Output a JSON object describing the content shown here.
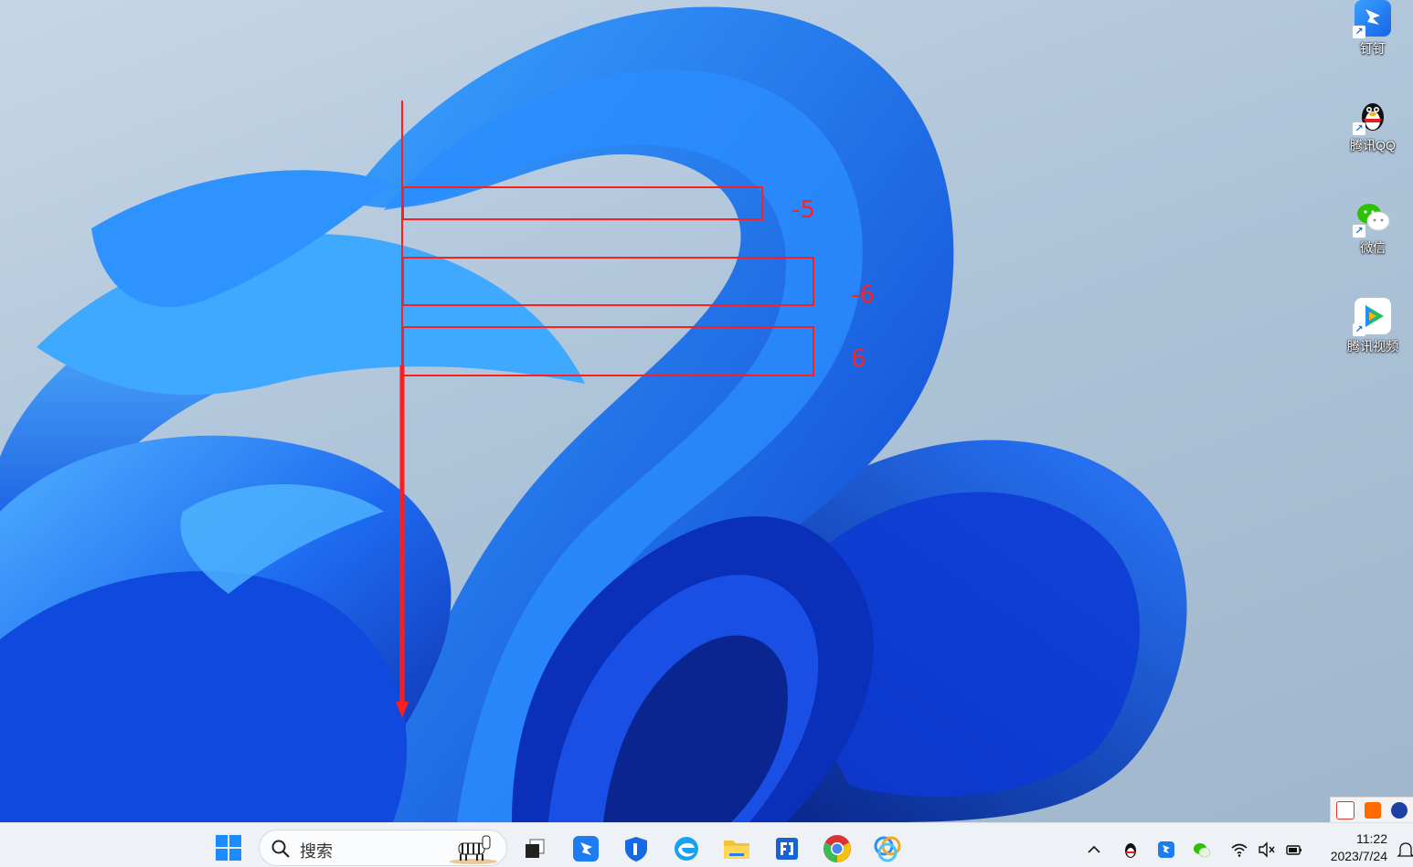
{
  "desktop_icons": [
    {
      "name": "钉钉"
    },
    {
      "name": "腾讯QQ"
    },
    {
      "name": "微信"
    },
    {
      "name": "腾讯视频"
    }
  ],
  "annotations": {
    "labels": [
      "-5",
      "-6",
      "6"
    ],
    "color": "#ff1e1e"
  },
  "taskbar": {
    "search_placeholder": "搜索",
    "pinned_apps": [
      "start-menu",
      "search",
      "task-view",
      "dingtalk",
      "lenovo-manager",
      "edge",
      "file-explorer",
      "fs-app",
      "chrome",
      "app-circles"
    ],
    "tray": [
      "show-hidden-icons",
      "qq",
      "dingtalk",
      "wechat",
      "wifi",
      "volume-muted",
      "battery"
    ],
    "time": "11:22",
    "date": "2023/7/24"
  },
  "colors": {
    "taskbar_bg": "#eef2f7",
    "wallpaper_accent": "#1a56e8"
  }
}
